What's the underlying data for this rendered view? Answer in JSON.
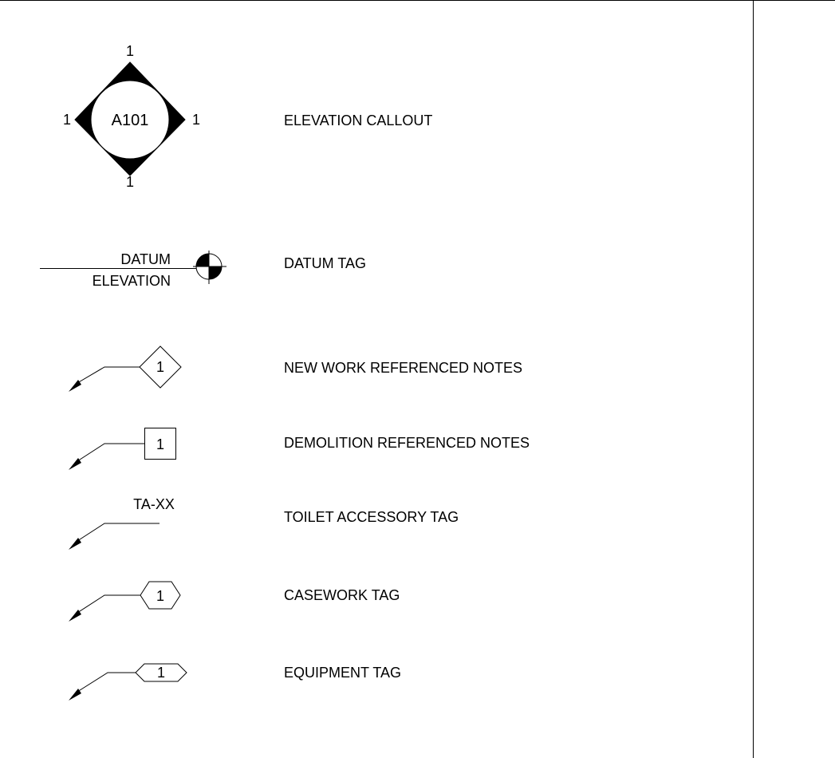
{
  "legend": {
    "rows": [
      {
        "symbol": "elevation-callout",
        "description": "ELEVATION CALLOUT",
        "labels": {
          "sheet": "A101",
          "top": "1",
          "left": "1",
          "right": "1",
          "bottom": "1"
        }
      },
      {
        "symbol": "datum-tag",
        "description": "DATUM TAG",
        "labels": {
          "line1": "DATUM",
          "line2": "ELEVATION"
        }
      },
      {
        "symbol": "diamond-tag",
        "description": "NEW WORK REFERENCED NOTES",
        "labels": {
          "number": "1"
        }
      },
      {
        "symbol": "square-tag",
        "description": "DEMOLITION REFERENCED NOTES",
        "labels": {
          "number": "1"
        }
      },
      {
        "symbol": "text-tag",
        "description": "TOILET ACCESSORY TAG",
        "labels": {
          "text": "TA-XX"
        }
      },
      {
        "symbol": "hexagon-tag",
        "description": "CASEWORK TAG",
        "labels": {
          "number": "1"
        }
      },
      {
        "symbol": "elongated-hexagon-tag",
        "description": "EQUIPMENT TAG",
        "labels": {
          "number": "1"
        }
      }
    ]
  }
}
